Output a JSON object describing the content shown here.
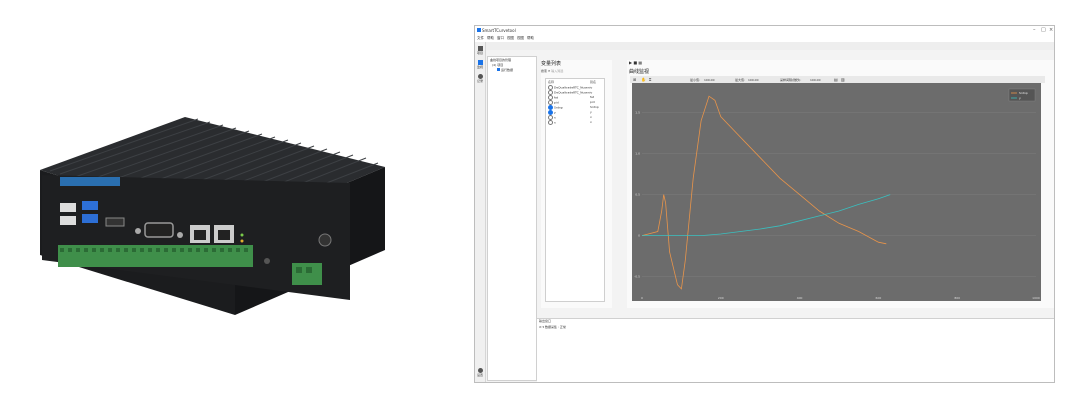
{
  "window": {
    "title": "SmartTCurvetool",
    "menu": [
      "文件",
      "帮助",
      "窗口",
      "视图",
      "视图",
      "帮助"
    ],
    "controls": [
      "–",
      "□",
      "×"
    ]
  },
  "left_bar": {
    "items": [
      {
        "icon": "project-icon",
        "label": "项目"
      },
      {
        "icon": "monitor-icon",
        "label": "监视"
      },
      {
        "icon": "record-icon",
        "label": "记录"
      }
    ],
    "bottom": {
      "icon": "settings-icon",
      "label": "设置"
    }
  },
  "project_tree": {
    "header": "曲线项目的管理",
    "items": [
      "(4) 项目",
      "运行数据"
    ]
  },
  "variable_panel": {
    "title": "变量列表",
    "search_label": "搜索",
    "search_placeholder": "输入筛选",
    "columns": [
      "名称",
      "别名"
    ],
    "rows": [
      {
        "name": "DeQualtradeRTC_Nuseniv",
        "alias": "",
        "checked": false
      },
      {
        "name": "DeQualtradeRTC_Nuseniv",
        "alias": "",
        "checked": false
      },
      {
        "name": "fat",
        "alias": "fat",
        "checked": false
      },
      {
        "name": "pid",
        "alias": "pid",
        "checked": false
      },
      {
        "name": "Sntnp",
        "alias": "Sntnp",
        "checked": true
      },
      {
        "name": "y",
        "alias": "y",
        "checked": true
      },
      {
        "name": "x",
        "alias": "x",
        "checked": false
      },
      {
        "name": "x",
        "alias": "x",
        "checked": false
      }
    ]
  },
  "chart_panel": {
    "title": "曲线监视",
    "toolbar_labels": [
      "最小值:",
      "100.00",
      "最大值:",
      "100.00",
      "采样间隔(微秒):",
      "100.00"
    ],
    "legend": [
      "Sntnp",
      "y"
    ]
  },
  "output_panel": {
    "title": "输出窗口",
    "status": "数据采集 : 正常"
  },
  "colors": {
    "plot_bg": "#6c6c6c",
    "series1": "#e8944a",
    "series2": "#39c0c0",
    "accent": "#1a73e8"
  },
  "chart_data": {
    "type": "line",
    "x_ticks": [
      "0",
      "200",
      "400",
      "600",
      "800",
      "1000"
    ],
    "y_ticks": [
      "1.5",
      "1.0",
      "0.5",
      "0",
      "-0.5"
    ],
    "xlim": [
      0,
      1000
    ],
    "ylim": [
      -0.7,
      1.8
    ],
    "series": [
      {
        "name": "Sntnp",
        "x": [
          0,
          40,
          50,
          55,
          60,
          70,
          90,
          100,
          110,
          130,
          150,
          170,
          185,
          200,
          230,
          260,
          300,
          350,
          400,
          450,
          500,
          550,
          600,
          620
        ],
        "y": [
          0.0,
          0.05,
          0.3,
          0.5,
          0.4,
          -0.2,
          -0.6,
          -0.65,
          -0.3,
          0.7,
          1.4,
          1.7,
          1.65,
          1.45,
          1.3,
          1.15,
          0.95,
          0.7,
          0.5,
          0.3,
          0.15,
          0.05,
          -0.08,
          -0.1
        ]
      },
      {
        "name": "y",
        "x": [
          0,
          100,
          150,
          200,
          250,
          300,
          350,
          400,
          450,
          500,
          550,
          600,
          630
        ],
        "y": [
          0.0,
          0.0,
          0.0,
          0.02,
          0.05,
          0.08,
          0.12,
          0.18,
          0.24,
          0.3,
          0.38,
          0.45,
          0.5
        ]
      }
    ]
  }
}
